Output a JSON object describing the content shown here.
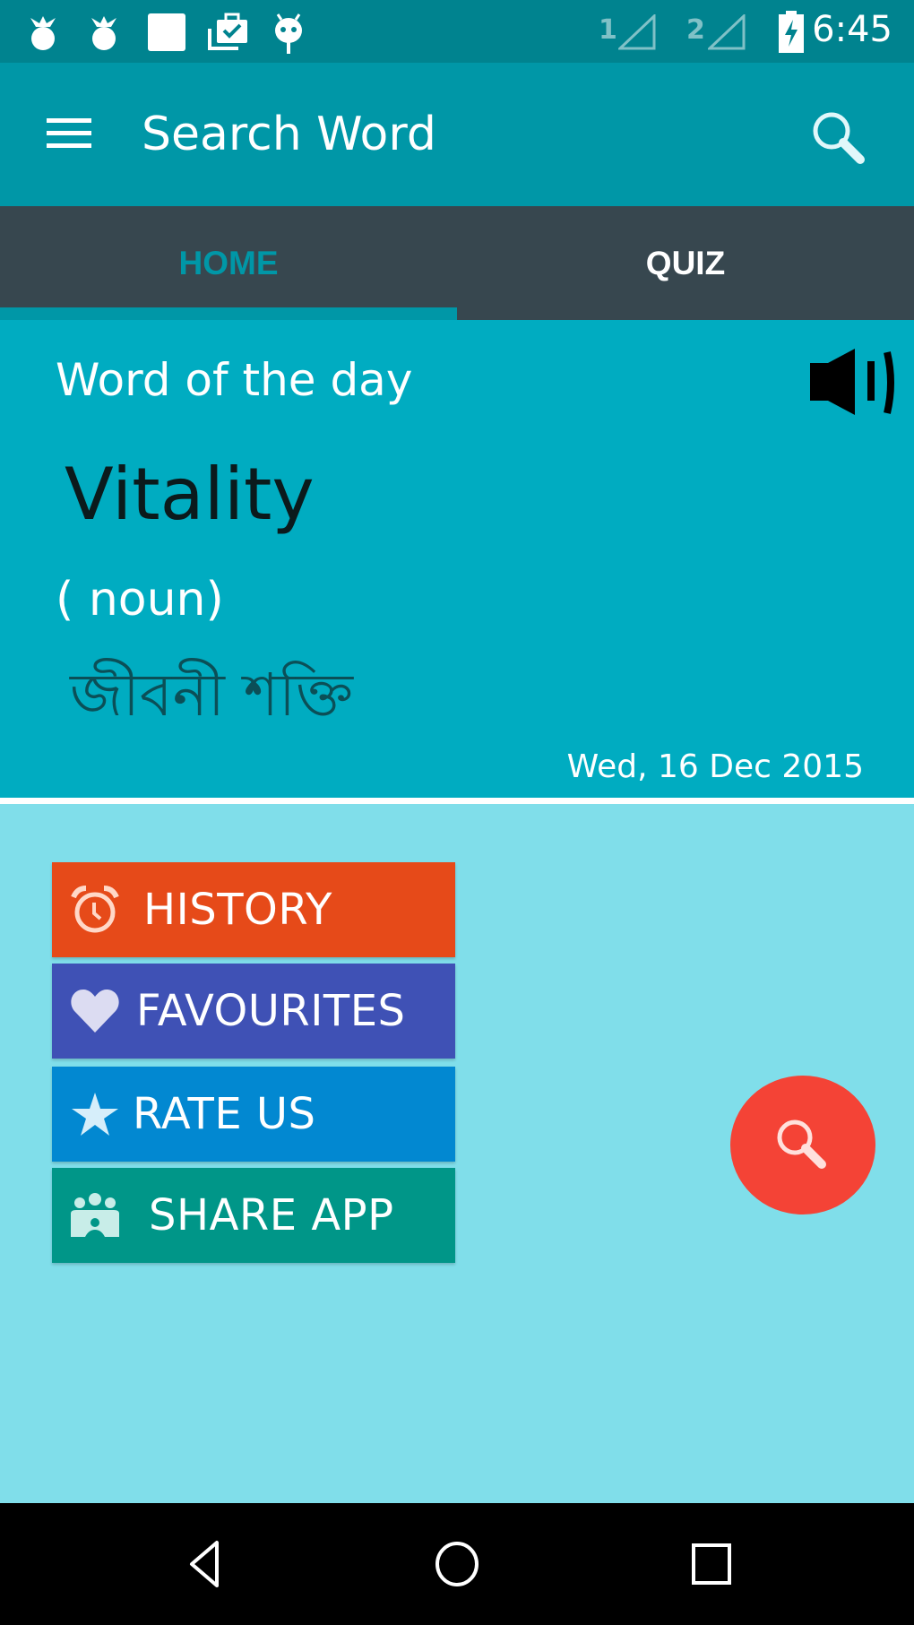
{
  "status_bar": {
    "left_icons": [
      "notification-bomb-icon",
      "notification-bomb-icon",
      "notification-square-icon",
      "notification-briefcase-check-icon",
      "notification-android-icon"
    ],
    "sim1_label": "1",
    "sim2_label": "2",
    "battery_state": "charging",
    "time": "6:45"
  },
  "app_bar": {
    "title": "Search Word",
    "menu_icon": "hamburger-menu-icon",
    "search_icon": "search-icon"
  },
  "tabs": [
    {
      "label": "HOME",
      "selected": true
    },
    {
      "label": "QUIZ",
      "selected": false
    }
  ],
  "word_of_the_day": {
    "heading": "Word of the day",
    "word": "Vitality",
    "part_of_speech": "( noun)",
    "translation": "জীবনী শক্তি",
    "date": "Wed, 16 Dec 2015",
    "speaker_icon": "speaker-volume-icon"
  },
  "actions": [
    {
      "label": "HISTORY",
      "icon": "alarm-clock-icon",
      "color": "#e64a19"
    },
    {
      "label": "FAVOURITES",
      "icon": "heart-icon",
      "color": "#3f51b5"
    },
    {
      "label": "RATE US",
      "icon": "star-icon",
      "color": "#0288d1"
    },
    {
      "label": "SHARE APP",
      "icon": "group-share-icon",
      "color": "#009688"
    }
  ],
  "fab": {
    "icon": "search-icon",
    "color": "#f44336"
  },
  "nav_bar": {
    "back": "back-icon",
    "home": "home-icon",
    "recents": "recents-icon"
  },
  "colors": {
    "status_bar": "#00838f",
    "primary": "#0097a7",
    "tab_bar": "#37474f",
    "card": "#00acc1",
    "background": "#80deea"
  }
}
